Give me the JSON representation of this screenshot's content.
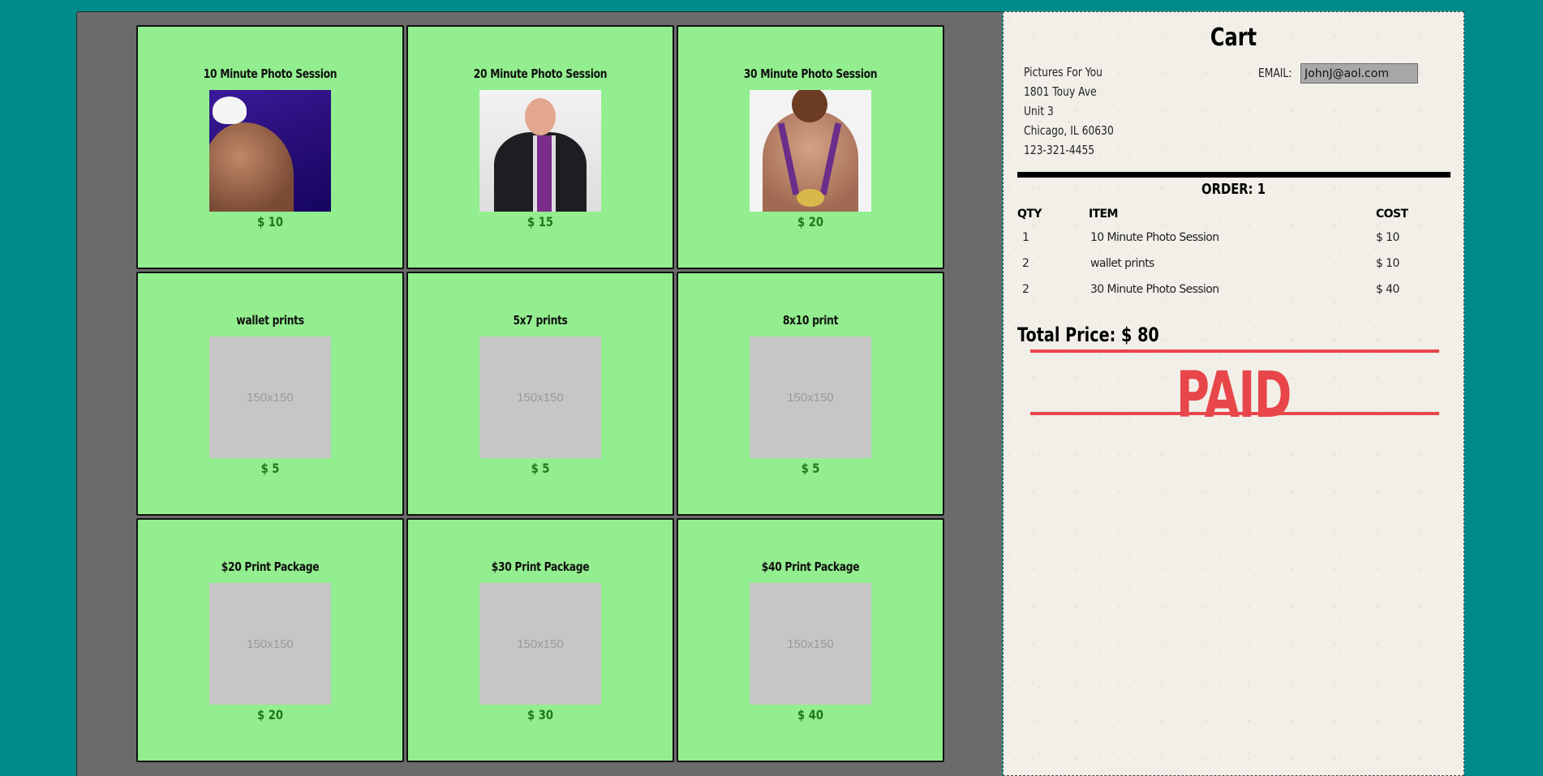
{
  "products": [
    {
      "name": "10 Minute Photo Session",
      "price": "$ 10",
      "image": "swimmer-photo"
    },
    {
      "name": "20 Minute Photo Session",
      "price": "$ 15",
      "image": "man-in-suit-photo"
    },
    {
      "name": "30 Minute Photo Session",
      "price": "$ 20",
      "image": "athlete-medals-photo"
    },
    {
      "name": "wallet prints",
      "price": "$ 5",
      "placeholder": "150x150"
    },
    {
      "name": "5x7 prints",
      "price": "$ 5",
      "placeholder": "150x150"
    },
    {
      "name": "8x10 print",
      "price": "$ 5",
      "placeholder": "150x150"
    },
    {
      "name": "$20 Print Package",
      "price": "$ 20",
      "placeholder": "150x150"
    },
    {
      "name": "$30 Print Package",
      "price": "$ 30",
      "placeholder": "150x150"
    },
    {
      "name": "$40 Print Package",
      "price": "$ 40",
      "placeholder": "150x150"
    }
  ],
  "cart": {
    "title": "Cart",
    "address": [
      "Pictures For You",
      "1801 Touy Ave",
      "Unit 3",
      "Chicago, IL 60630",
      "123-321-4455"
    ],
    "email_label": "EMAIL:",
    "email_value": "JohnJ@aol.com",
    "order_label": "ORDER: 1",
    "columns": [
      "QTY",
      "ITEM",
      "COST"
    ],
    "rows": [
      {
        "qty": "1",
        "item": "10 Minute Photo Session",
        "cost": "$ 10"
      },
      {
        "qty": "2",
        "item": "wallet prints",
        "cost": "$ 10"
      },
      {
        "qty": "2",
        "item": "30 Minute Photo Session",
        "cost": "$ 40"
      }
    ],
    "total": "Total Price: $ 80",
    "stamp": "PAID"
  },
  "colors": {
    "background": "#008b8b",
    "shop_panel": "#6b6b6b",
    "card": "#93ee8f",
    "price": "#1c7a1c",
    "paid_stamp": "#e8464a"
  }
}
